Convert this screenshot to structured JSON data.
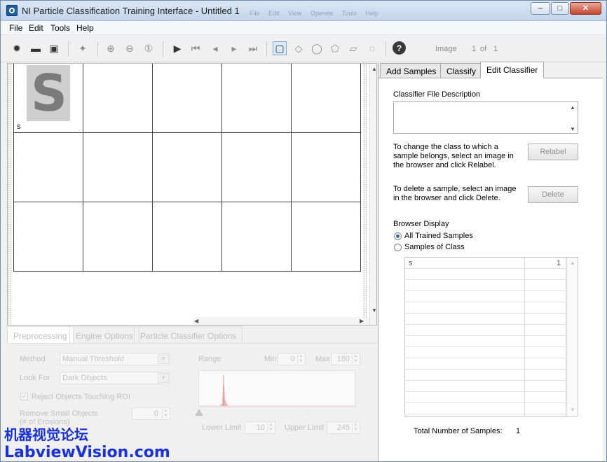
{
  "window": {
    "title": "NI Particle Classification Training Interface - Untitled 1",
    "ghost_menu": [
      "File",
      "Edit",
      "View",
      "Operate",
      "Tools",
      "Help"
    ],
    "buttons": {
      "minimize": "–",
      "maximize": "□",
      "close": "✕"
    }
  },
  "menu": [
    "File",
    "Edit",
    "Tools",
    "Help"
  ],
  "toolbar": {
    "icons": {
      "new": "✹",
      "open": "▬",
      "save": "▣",
      "add_samples": "✦",
      "zoom_in": "⊕",
      "zoom_out": "⊖",
      "zoom_fit": "①",
      "play": "▶",
      "first": "⏮",
      "prev": "◂",
      "next": "▸",
      "last": "⏭",
      "rect": "▢",
      "rotated_rect": "◇",
      "oval": "◯",
      "polygon": "⬠",
      "freehand": "▱",
      "annulus": "◌",
      "help": "?"
    },
    "image_label": "Image",
    "image_index": "1",
    "of_label": "of",
    "image_total": "1"
  },
  "browser": {
    "cell_label": "s",
    "sample_glyph": "S",
    "scroll_up": "▲",
    "scroll_down": "▼",
    "scroll_left": "◀",
    "scroll_right": "▶"
  },
  "lower_tabs": [
    "Preprocessing",
    "Engine Options",
    "Particle Classifier Options"
  ],
  "preprocessing": {
    "method_label": "Method",
    "method_value": "Manual Threshold",
    "lookfor_label": "Look For",
    "lookfor_value": "Dark Objects",
    "reject_label": "Reject Objects Touching ROI",
    "remove_label": "Remove Small Objects",
    "erosions_label": "(# of Erosions)",
    "remove_value": "0",
    "range_label": "Range",
    "min_label": "Min",
    "min_value": "0",
    "max_label": "Max",
    "max_value": "180",
    "lower_label": "Lower Limit",
    "lower_value": "10",
    "upper_label": "Upper Limit",
    "upper_value": "245"
  },
  "right_tabs": [
    "Add Samples",
    "Classify",
    "Edit Classifier"
  ],
  "edit_classifier": {
    "desc_label": "Classifier File Description",
    "relabel_text": [
      "To change the class to which a",
      "sample belongs, select an image in",
      "the browser and click Relabel."
    ],
    "relabel_button": "Relabel",
    "delete_text": [
      "To delete a sample, select an image",
      "in the browser and click Delete."
    ],
    "delete_button": "Delete",
    "display_label": "Browser Display",
    "radio_all": "All Trained Samples",
    "radio_class": "Samples of Class",
    "list_rows": [
      {
        "name": "s",
        "count": "1"
      }
    ],
    "total_label": "Total Number of Samples:",
    "total_value": "1"
  },
  "watermark": {
    "line1": "机器视觉论坛",
    "line2": "LabviewVision.com"
  }
}
